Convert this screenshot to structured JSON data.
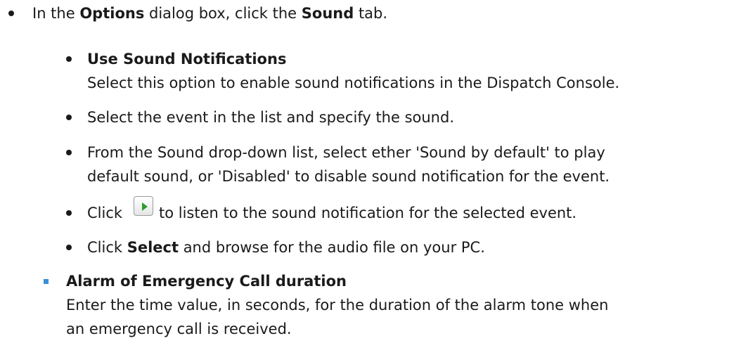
{
  "main": {
    "intro": {
      "prefix": "In the ",
      "options": "Options",
      "middle": " dialog box, click the ",
      "sound": "Sound",
      "suffix": " tab."
    },
    "items": [
      {
        "title": "Use Sound Notifications",
        "desc": "Select this option to enable sound notifications in the Dispatch Console."
      },
      {
        "text": "Select the event in the list and specify the sound."
      },
      {
        "line1": "From the Sound drop-down list, select ether 'Sound by default' to play",
        "line2": "default sound, or 'Disabled' to disable sound notification for the event."
      },
      {
        "prefix": "Click ",
        "suffix": " to listen to the sound notification for the selected event."
      },
      {
        "prefix": "Click ",
        "select": "Select",
        "suffix": " and browse for the audio file on your PC."
      }
    ],
    "alarm": {
      "title": "Alarm of Emergency Call duration",
      "line1": "Enter the time value, in seconds, for the duration of the alarm tone when",
      "line2": "an emergency call is received."
    },
    "icons": {
      "play": "play-icon",
      "bullet_color": "#1a1a1a",
      "square_bullet_color": "#3a8fd6"
    }
  }
}
